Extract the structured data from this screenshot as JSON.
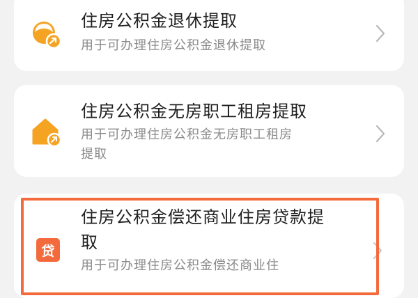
{
  "items": [
    {
      "title": "住房公积金退休提取",
      "subtitle": "用于可办理住房公积金退休提取",
      "icon": "retiree-refund-icon"
    },
    {
      "title": "住房公积金无房职工租房提取",
      "subtitle": "用于可办理住房公积金无房职工租房提取",
      "icon": "house-refund-icon"
    },
    {
      "title": "住房公积金偿还商业住房贷款提取",
      "subtitle": "用于可办理住房公积金偿还商业住",
      "icon": "loan-icon",
      "icon_text": "贷"
    }
  ],
  "colors": {
    "accent": "#f5a323",
    "highlight": "#f36b3c",
    "title": "#1f1f1f",
    "subtitle": "#8a8a8a",
    "background": "#f2f2f2"
  }
}
